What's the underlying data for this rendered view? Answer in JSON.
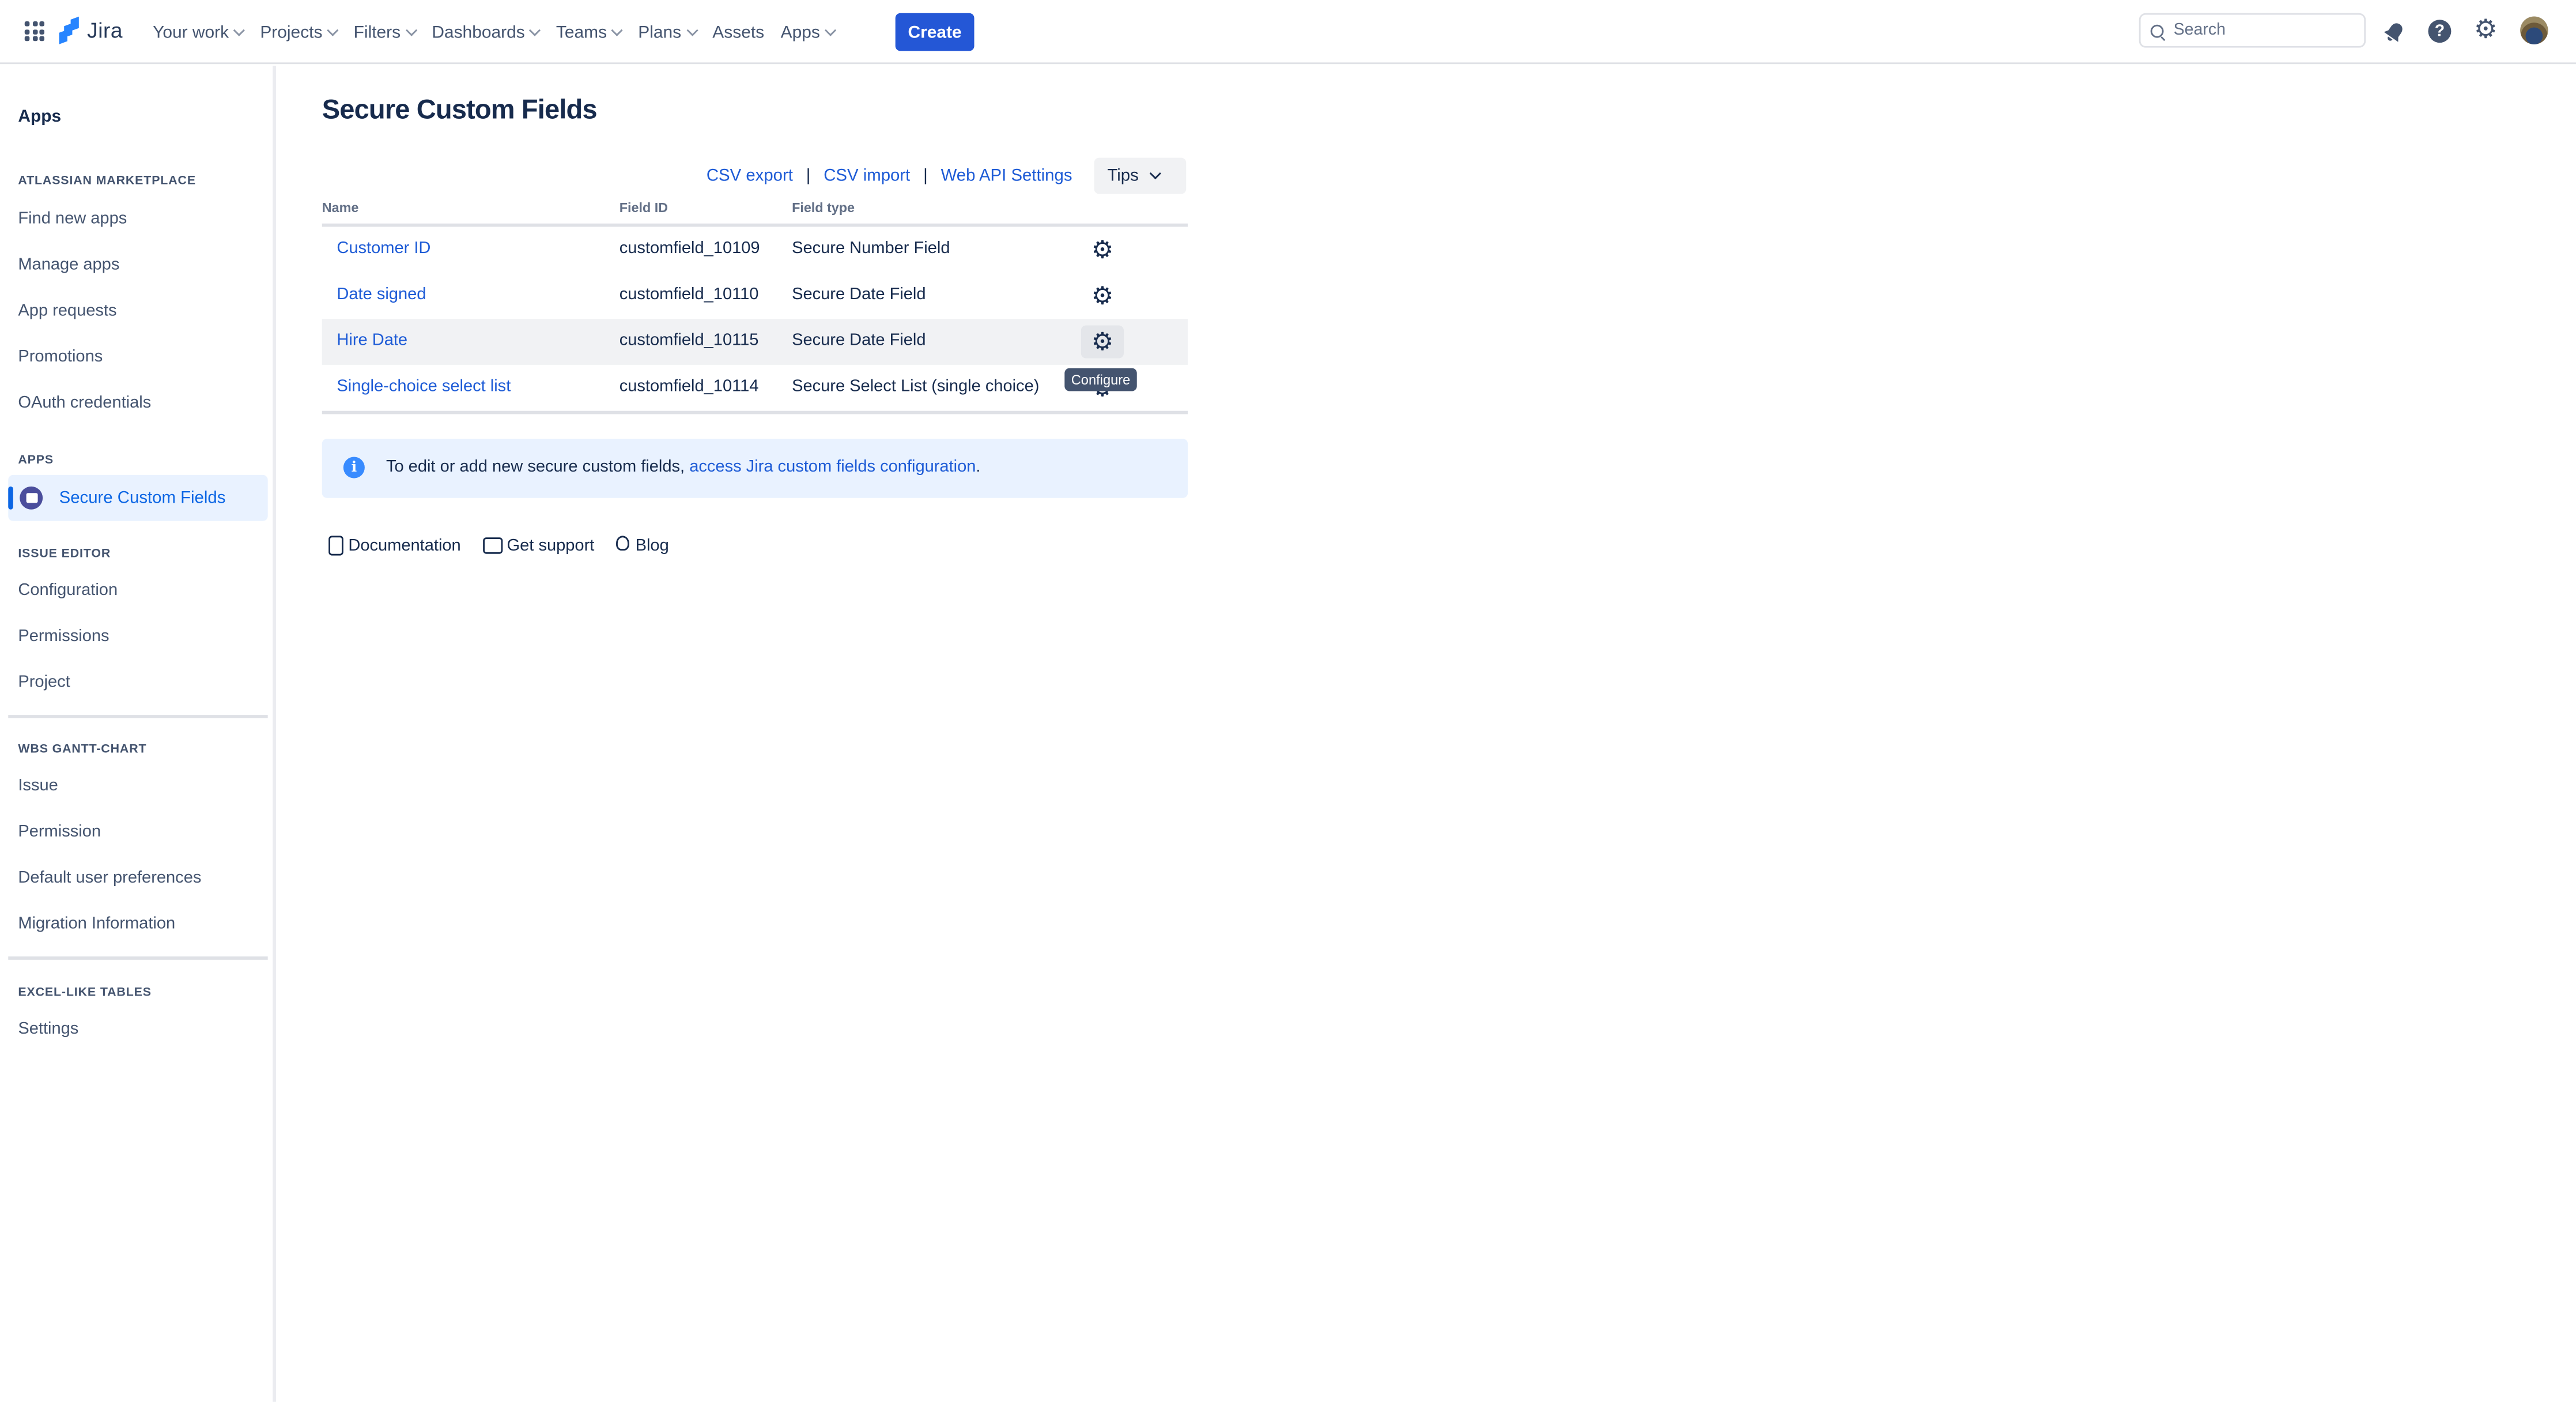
{
  "topnav": {
    "product": "Jira",
    "items": [
      {
        "label": "Your work",
        "has_dropdown": true
      },
      {
        "label": "Projects",
        "has_dropdown": true
      },
      {
        "label": "Filters",
        "has_dropdown": true
      },
      {
        "label": "Dashboards",
        "has_dropdown": true
      },
      {
        "label": "Teams",
        "has_dropdown": true
      },
      {
        "label": "Plans",
        "has_dropdown": true
      },
      {
        "label": "Assets",
        "has_dropdown": false
      },
      {
        "label": "Apps",
        "has_dropdown": true
      }
    ],
    "create_label": "Create",
    "search_placeholder": "Search",
    "icons": [
      "app-switcher-icon",
      "notifications-icon",
      "help-icon",
      "settings-icon",
      "avatar"
    ],
    "help_glyph": "?",
    "settings_glyph": "⚙"
  },
  "sidebar": {
    "title": "Apps",
    "sections": [
      {
        "heading": "ATLASSIAN MARKETPLACE",
        "items": [
          "Find new apps",
          "Manage apps",
          "App requests",
          "Promotions",
          "OAuth credentials"
        ]
      },
      {
        "heading": "APPS",
        "items": [
          "Secure Custom Fields"
        ],
        "active": "Secure Custom Fields"
      },
      {
        "heading": "ISSUE EDITOR",
        "items": [
          "Configuration",
          "Permissions",
          "Project"
        ]
      },
      {
        "heading": "WBS GANTT-CHART",
        "items": [
          "Issue",
          "Permission",
          "Default user preferences",
          "Migration Information"
        ]
      },
      {
        "heading": "EXCEL-LIKE TABLES",
        "items": [
          "Settings"
        ]
      }
    ]
  },
  "main": {
    "title": "Secure Custom Fields",
    "actions": {
      "csv_export": "CSV export",
      "csv_import": "CSV import",
      "web_api": "Web API Settings",
      "separator": "|",
      "tips": "Tips"
    },
    "table": {
      "columns": [
        "Name",
        "Field ID",
        "Field type"
      ],
      "rows": [
        {
          "name": "Customer ID",
          "field_id": "customfield_10109",
          "field_type": "Secure Number Field"
        },
        {
          "name": "Date signed",
          "field_id": "customfield_10110",
          "field_type": "Secure Date Field"
        },
        {
          "name": "Hire Date",
          "field_id": "customfield_10115",
          "field_type": "Secure Date Field"
        },
        {
          "name": "Single-choice select list",
          "field_id": "customfield_10114",
          "field_type": "Secure Select List (single choice)"
        }
      ],
      "gear_glyph": "⚙",
      "tooltip": "Configure"
    },
    "info": {
      "icon_glyph": "i",
      "text": "To edit or add new secure custom fields, ",
      "link": "access Jira custom fields configuration",
      "suffix": "."
    },
    "footer_links": [
      "Documentation",
      "Get support",
      "Blog"
    ]
  },
  "colors": {
    "accent": "#0c66e4",
    "link": "#1d5bd6",
    "info_bg": "#e9f2ff",
    "hover_row": "#f1f2f4"
  }
}
